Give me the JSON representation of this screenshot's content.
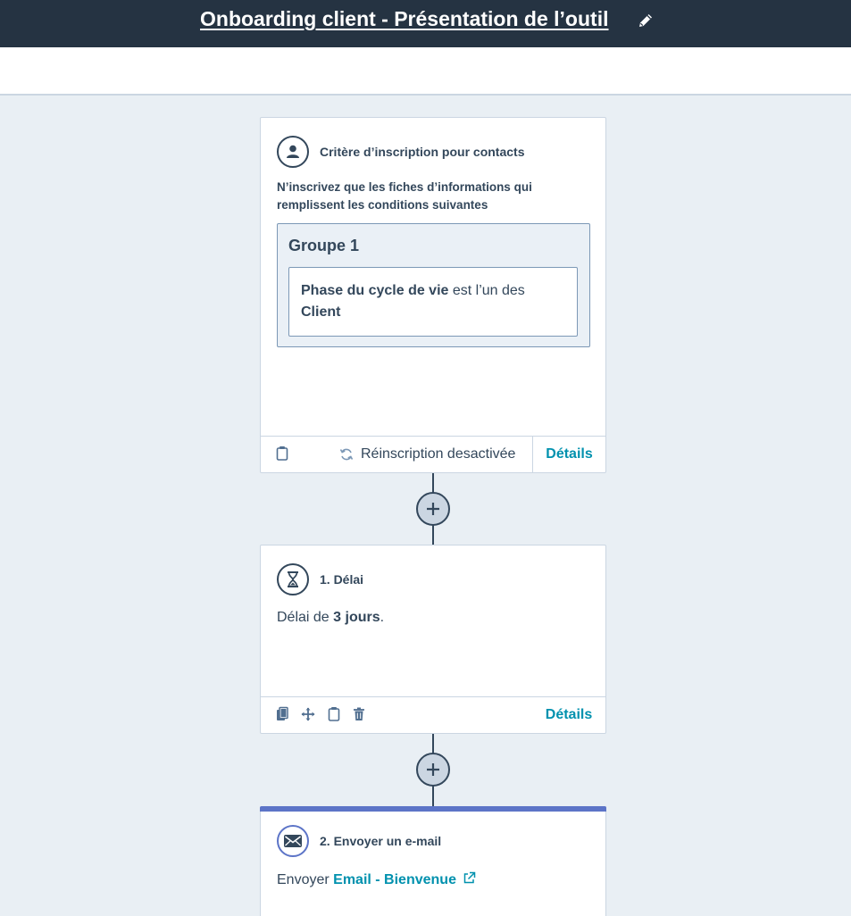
{
  "header": {
    "title": "Onboarding client - Présentation de l’outil",
    "edit_icon": "pencil-icon"
  },
  "colors": {
    "header_bg": "#253342",
    "canvas_bg": "#e9eff4",
    "link": "#0091ae",
    "email_accent": "#5c74c7"
  },
  "enrollment": {
    "title": "Critère d’inscription pour contacts",
    "icon": "contact-icon",
    "description": "N’inscrivez que les fiches d’informations qui remplissent les conditions suivantes",
    "group": {
      "title": "Groupe 1",
      "condition_property": "Phase du cycle de vie",
      "condition_operator": " est l’un des",
      "condition_value": "Client"
    },
    "footer": {
      "reenroll_label": "Réinscription desactivée",
      "details_label": "Détails"
    }
  },
  "steps": [
    {
      "title": "1. Délai",
      "icon": "hourglass-icon",
      "text_prefix": "Délai de ",
      "text_value": "3 jours",
      "text_suffix": ".",
      "details_label": "Détails"
    },
    {
      "title": "2. Envoyer un e-mail",
      "icon": "email-icon",
      "text_prefix": "Envoyer ",
      "link_text": "Email - Bienvenue"
    }
  ]
}
